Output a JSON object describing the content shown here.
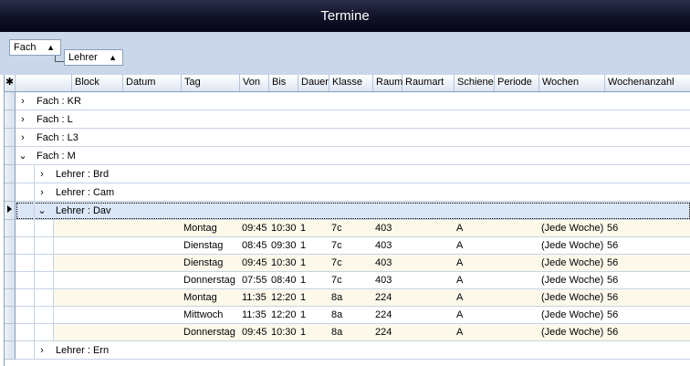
{
  "window": {
    "title": "Termine"
  },
  "group_by": [
    {
      "label": "Fach",
      "arrow": "▲"
    },
    {
      "label": "Lehrer",
      "arrow": "▲"
    }
  ],
  "grid": {
    "new_row_marker": "✱",
    "columns": [
      "Block",
      "Datum",
      "Tag",
      "Von",
      "Bis",
      "Dauer",
      "Klasse",
      "Raum",
      "Raumart",
      "Schiene",
      "Periode",
      "Wochen",
      "Wochenanzahl"
    ],
    "collapsed_icon": "›",
    "expanded_icon": "⌄",
    "fach_groups_top": [
      {
        "label": "Fach : KR",
        "expanded": false
      },
      {
        "label": "Fach : L",
        "expanded": false
      },
      {
        "label": "Fach : L3",
        "expanded": false
      },
      {
        "label": "Fach : M",
        "expanded": true
      }
    ],
    "lehrer_groups": [
      {
        "label": "Lehrer : Brd",
        "expanded": false
      },
      {
        "label": "Lehrer : Cam",
        "expanded": false
      },
      {
        "label": "Lehrer : Dav",
        "expanded": true,
        "selected": true
      }
    ],
    "rows": [
      {
        "Tag": "Montag",
        "Von": "09:45",
        "Bis": "10:30",
        "Dauer": "1",
        "Klasse": "7c",
        "Raum": "403",
        "Schiene": "A",
        "Wochen": "(Jede Woche)",
        "Wochenanzahl": "56"
      },
      {
        "Tag": "Dienstag",
        "Von": "08:45",
        "Bis": "09:30",
        "Dauer": "1",
        "Klasse": "7c",
        "Raum": "403",
        "Schiene": "A",
        "Wochen": "(Jede Woche)",
        "Wochenanzahl": "56"
      },
      {
        "Tag": "Dienstag",
        "Von": "09:45",
        "Bis": "10:30",
        "Dauer": "1",
        "Klasse": "7c",
        "Raum": "403",
        "Schiene": "A",
        "Wochen": "(Jede Woche)",
        "Wochenanzahl": "56"
      },
      {
        "Tag": "Donnerstag",
        "Von": "07:55",
        "Bis": "08:40",
        "Dauer": "1",
        "Klasse": "7c",
        "Raum": "403",
        "Schiene": "A",
        "Wochen": "(Jede Woche)",
        "Wochenanzahl": "56"
      },
      {
        "Tag": "Montag",
        "Von": "11:35",
        "Bis": "12:20",
        "Dauer": "1",
        "Klasse": "8a",
        "Raum": "224",
        "Schiene": "A",
        "Wochen": "(Jede Woche)",
        "Wochenanzahl": "56"
      },
      {
        "Tag": "Mittwoch",
        "Von": "11:35",
        "Bis": "12:20",
        "Dauer": "1",
        "Klasse": "8a",
        "Raum": "224",
        "Schiene": "A",
        "Wochen": "(Jede Woche)",
        "Wochenanzahl": "56"
      },
      {
        "Tag": "Donnerstag",
        "Von": "09:45",
        "Bis": "10:30",
        "Dauer": "1",
        "Klasse": "8a",
        "Raum": "224",
        "Schiene": "A",
        "Wochen": "(Jede Woche)",
        "Wochenanzahl": "56"
      }
    ],
    "lehrer_groups_after": [
      {
        "label": "Lehrer : Ern",
        "expanded": false
      }
    ],
    "alt_row_color": "#fcf8ea",
    "selected_row_color": "#dbe6f6"
  }
}
